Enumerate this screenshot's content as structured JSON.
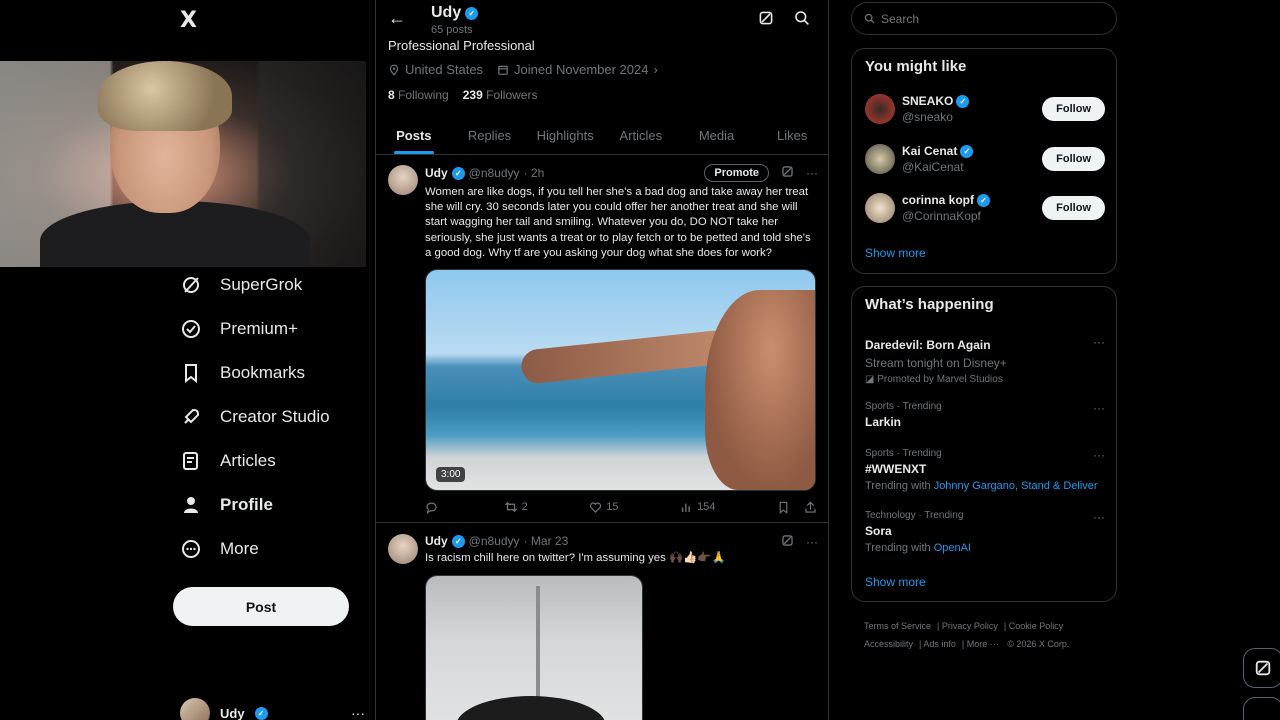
{
  "nav": {
    "logo": "X",
    "items": [
      {
        "label": "SuperGrok",
        "icon": "grok-icon"
      },
      {
        "label": "Premium+",
        "icon": "premium-icon"
      },
      {
        "label": "Bookmarks",
        "icon": "bookmark-icon"
      },
      {
        "label": "Creator Studio",
        "icon": "rocket-icon"
      },
      {
        "label": "Articles",
        "icon": "articles-icon"
      },
      {
        "label": "Profile",
        "icon": "profile-icon"
      },
      {
        "label": "More",
        "icon": "more-circle-icon"
      }
    ],
    "post_label": "Post",
    "account_name": "Udy"
  },
  "profile": {
    "name": "Udy",
    "posts_count": "65 posts",
    "bio": "Professional Professional",
    "location": "United States",
    "joined": "Joined November 2024",
    "following_count": "8",
    "following_label": "Following",
    "followers_count": "239",
    "followers_label": "Followers",
    "tabs": [
      "Posts",
      "Replies",
      "Highlights",
      "Articles",
      "Media",
      "Likes"
    ]
  },
  "tweets": [
    {
      "name": "Udy",
      "handle": "@n8udyy",
      "time": "· 2h",
      "promote_label": "Promote",
      "text": "Women are like dogs, if you tell her she's a bad dog and take away her treat she will cry. 30 seconds later you could offer her another treat and she will start wagging her tail and smiling. Whatever you do, DO NOT take her seriously, she just wants a treat or to play fetch or to be petted and told she's a good dog. Why tf are you asking your dog what she does for work?",
      "duration": "3:00",
      "replies": "",
      "reposts": "2",
      "likes": "15",
      "views": "154"
    },
    {
      "name": "Udy",
      "handle": "@n8udyy",
      "time": "· Mar 23",
      "text": "Is racism chill here on twitter? I'm assuming yes 🙌🏿👍🏻👉🏿🙏"
    }
  ],
  "sidebar": {
    "search_placeholder": "Search",
    "might_like_title": "You might like",
    "suggestions": [
      {
        "name": "SNEAKO",
        "handle": "@sneako",
        "follow": "Follow",
        "color": "#c0392b"
      },
      {
        "name": "Kai Cenat",
        "handle": "@KaiCenat",
        "follow": "Follow",
        "color": "#6b6b5a"
      },
      {
        "name": "corinna kopf",
        "handle": "@CorinnaKopf",
        "follow": "Follow",
        "color": "#c9b49a"
      }
    ],
    "show_more": "Show more",
    "happening_title": "What’s happening",
    "trends": [
      {
        "category": "",
        "title": "Daredevil: Born Again",
        "sub": "Stream tonight on Disney+",
        "promo": "Promoted by Marvel Studios"
      },
      {
        "category": "Sports · Trending",
        "title": "Larkin"
      },
      {
        "category": "Sports · Trending",
        "title": "#WWENXT",
        "with_prefix": "Trending with",
        "with": "Johnny Gargano, Stand & Deliver"
      },
      {
        "category": "Technology · Trending",
        "title": "Sora",
        "with_prefix": "Trending with",
        "with": "OpenAI"
      }
    ],
    "show_more_2": "Show more",
    "footer": [
      "Terms of Service",
      "Privacy Policy",
      "Cookie Policy",
      "Accessibility",
      "Ads info",
      "More ···",
      "© 2026 X Corp."
    ]
  },
  "colors": {
    "accent": "#1d9bf0",
    "bg": "#000000",
    "border": "#2f3336",
    "muted": "#71767b"
  }
}
